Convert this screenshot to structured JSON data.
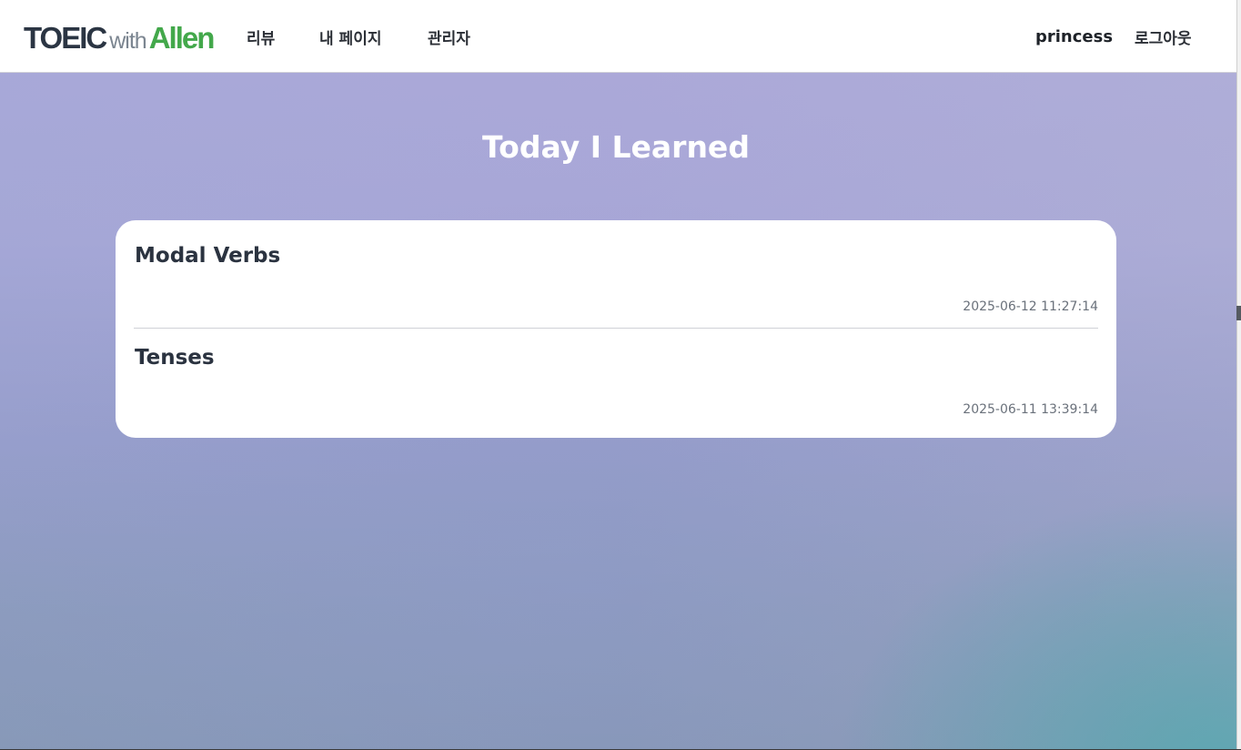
{
  "header": {
    "logo": {
      "part1": "TOEIC",
      "part2": "with",
      "part3": "Allen"
    },
    "nav": {
      "review": "리뷰",
      "my_page": "내 페이지",
      "admin": "관리자"
    },
    "username": "princess",
    "logout": "로그아웃"
  },
  "main": {
    "title": "Today I Learned",
    "entries": [
      {
        "title": "Modal Verbs",
        "date": "2025-06-12 11:27:14"
      },
      {
        "title": "Tenses",
        "date": "2025-06-11 13:39:14"
      }
    ]
  },
  "colors": {
    "brand_dark": "#2b3543",
    "brand_green": "#43a84b",
    "card_bg": "#ffffff"
  }
}
